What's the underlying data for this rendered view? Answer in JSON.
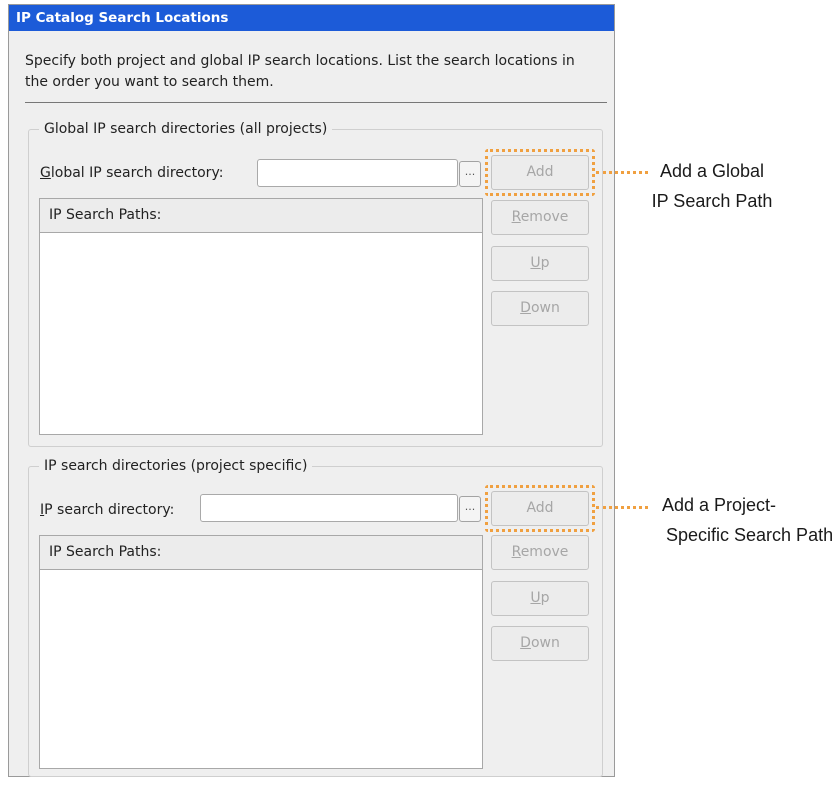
{
  "dialog": {
    "title": "IP Catalog Search Locations",
    "description": "Specify both project and global IP search locations. List the search locations in the order you want to search them."
  },
  "global_section": {
    "legend": "Global IP search directories (all projects)",
    "label_mnemonic": "G",
    "label_rest": "lobal IP search directory:",
    "input_value": "",
    "browse_label": "...",
    "add_label": "Add",
    "remove_mnemonic": "R",
    "remove_rest": "emove",
    "up_mnemonic": "U",
    "up_rest": "p",
    "down_mnemonic": "D",
    "down_rest": "own",
    "list_header": "IP Search Paths:",
    "paths": []
  },
  "project_section": {
    "legend": "IP search directories (project specific)",
    "label_mnemonic": "I",
    "label_rest": "P search directory:",
    "input_value": "",
    "browse_label": "...",
    "add_label": "Add",
    "remove_mnemonic": "R",
    "remove_rest": "emove",
    "up_mnemonic": "U",
    "up_rest": "p",
    "down_mnemonic": "D",
    "down_rest": "own",
    "list_header": "IP Search Paths:",
    "paths": []
  },
  "callouts": {
    "global_line1": "Add a Global",
    "global_line2": "IP Search Path",
    "project_line1": "Add a Project-",
    "project_line2": "Specific Search Path"
  },
  "colors": {
    "title_bar": "#1c5bd8",
    "highlight": "#f0a040",
    "dialog_bg": "#efefef"
  }
}
